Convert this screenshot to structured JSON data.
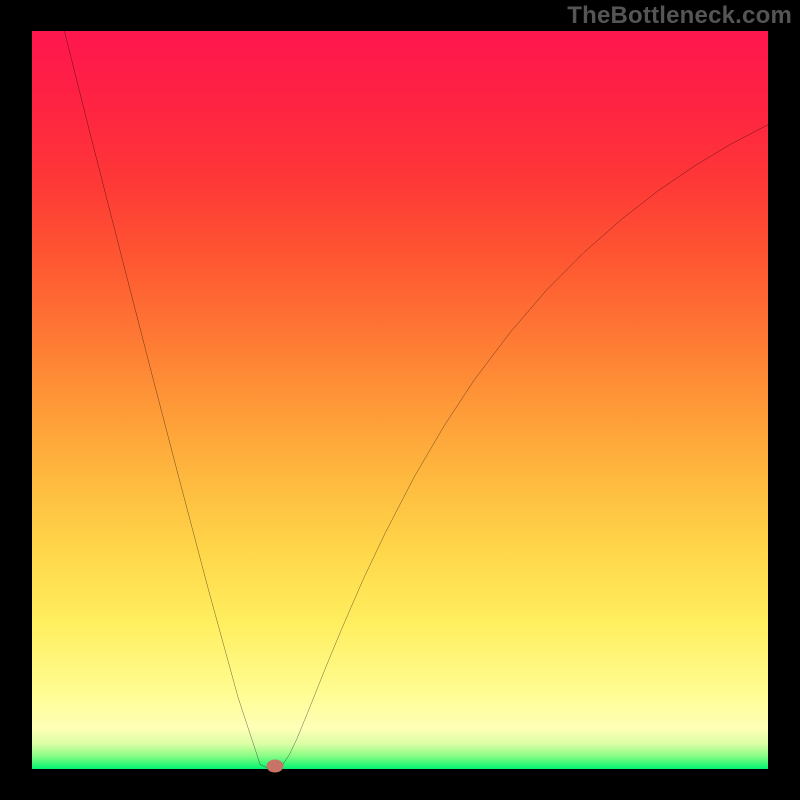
{
  "watermark": "TheBottleneck.com",
  "chart_data": {
    "type": "line",
    "title": "",
    "xlabel": "",
    "ylabel": "",
    "xlim": [
      0,
      100
    ],
    "ylim": [
      0,
      100
    ],
    "grid": false,
    "series": [
      {
        "name": "curve",
        "x": [
          4.4,
          8,
          12,
          16,
          20,
          24,
          28,
          31,
          32,
          33,
          34,
          35,
          36,
          38,
          40,
          42,
          45,
          48,
          52,
          56,
          60,
          65,
          70,
          75,
          80,
          85,
          90,
          95,
          100
        ],
        "values": [
          100,
          85.7,
          70.1,
          54.6,
          39.3,
          24.2,
          9.7,
          0.6,
          0.15,
          0.004,
          0.5,
          2.0,
          4.1,
          9.0,
          14.0,
          18.8,
          25.7,
          32.0,
          39.7,
          46.5,
          52.6,
          59.2,
          65.0,
          70.0,
          74.4,
          78.3,
          81.7,
          84.7,
          87.3
        ]
      }
    ],
    "marker": {
      "x": 33,
      "y": 0.38
    },
    "gradient_description": "vertical green-to-red via yellow/orange"
  }
}
